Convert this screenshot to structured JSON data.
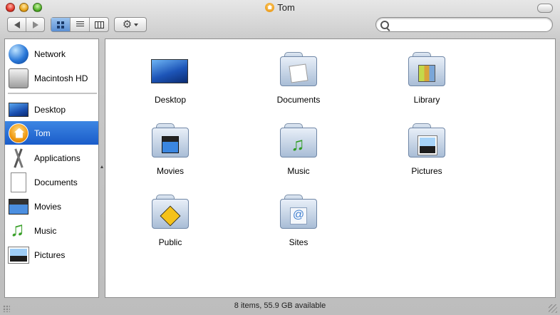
{
  "window": {
    "title": "Tom"
  },
  "search": {
    "placeholder": "",
    "value": ""
  },
  "sidebar": {
    "items": [
      {
        "label": "Network",
        "icon": "network-globe-icon"
      },
      {
        "label": "Macintosh HD",
        "icon": "hard-drive-icon"
      },
      {
        "label": "Desktop",
        "icon": "desktop-icon"
      },
      {
        "label": "Tom",
        "icon": "home-icon",
        "selected": true
      },
      {
        "label": "Applications",
        "icon": "applications-icon"
      },
      {
        "label": "Documents",
        "icon": "document-icon"
      },
      {
        "label": "Movies",
        "icon": "movie-clapper-icon"
      },
      {
        "label": "Music",
        "icon": "music-note-icon"
      },
      {
        "label": "Pictures",
        "icon": "picture-icon"
      }
    ]
  },
  "content": {
    "items": [
      {
        "label": "Desktop",
        "icon": "desktop-icon"
      },
      {
        "label": "Documents",
        "icon": "documents-folder-icon"
      },
      {
        "label": "Library",
        "icon": "library-folder-icon"
      },
      {
        "label": "Movies",
        "icon": "movies-folder-icon"
      },
      {
        "label": "Music",
        "icon": "music-folder-icon"
      },
      {
        "label": "Pictures",
        "icon": "pictures-folder-icon"
      },
      {
        "label": "Public",
        "icon": "public-folder-icon"
      },
      {
        "label": "Sites",
        "icon": "sites-folder-icon"
      }
    ]
  },
  "status": {
    "text": "8 items, 55.9 GB available"
  },
  "colors": {
    "selection": "#1a5cc9",
    "folder": "#a9bdd6"
  }
}
